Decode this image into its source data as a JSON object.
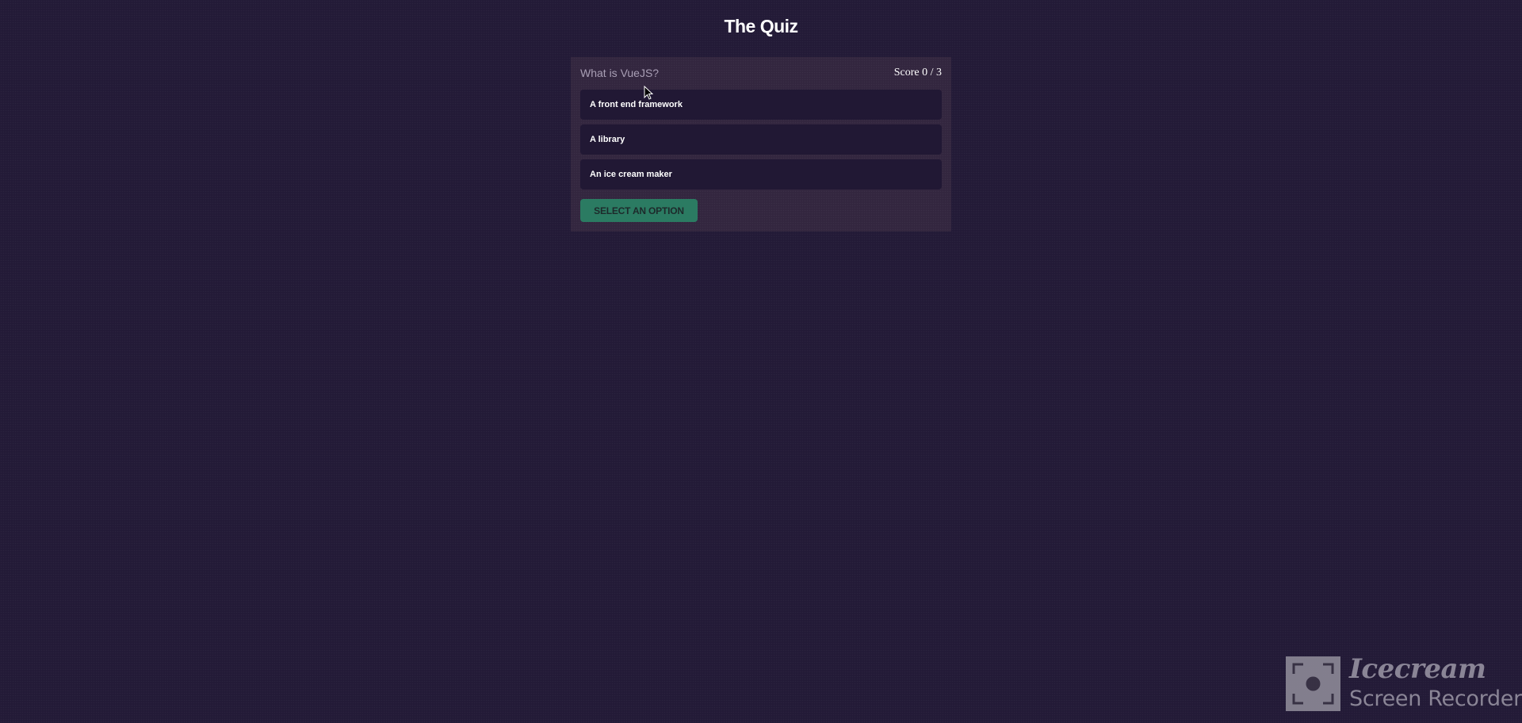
{
  "app": {
    "title": "The Quiz"
  },
  "quiz": {
    "question": "What is VueJS?",
    "score_text": "Score 0 / 3",
    "options": [
      {
        "label": "A front end framework"
      },
      {
        "label": "A library"
      },
      {
        "label": "An ice cream maker"
      }
    ],
    "submit_label": "SELECT AN OPTION"
  },
  "watermark": {
    "brand": "Icecream",
    "product": "Screen Recorder"
  },
  "colors": {
    "background": "#231a37",
    "card": "#33263f",
    "option": "#211834",
    "button": "#2b7b62"
  }
}
